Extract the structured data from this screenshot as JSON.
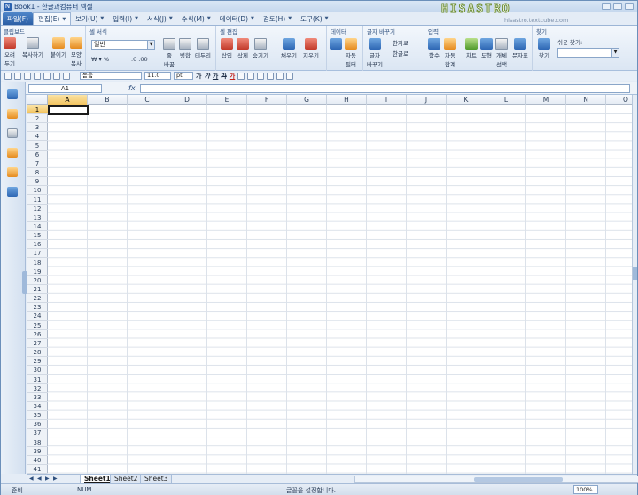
{
  "window": {
    "title": "Book1 - 한글과컴퓨터 넥셀"
  },
  "watermark": {
    "text": "HISASTRO",
    "url": "hisastro.textcube.com"
  },
  "menu": [
    {
      "label": "파일(F)",
      "kind": "file"
    },
    {
      "label": "편집(E)",
      "kind": "active"
    },
    {
      "label": "보기(U)"
    },
    {
      "label": "입력(I)"
    },
    {
      "label": "서식(J)"
    },
    {
      "label": "수식(M)"
    },
    {
      "label": "데이터(D)"
    },
    {
      "label": "검토(H)"
    },
    {
      "label": "도구(K)"
    }
  ],
  "ribbon": {
    "clipboard": {
      "title": "클립보드",
      "cut": "오려\n두기",
      "copy": "복사하기",
      "paste": "붙이기",
      "format_copy": "모양\n복사"
    },
    "cellformat": {
      "title": "셀 서식",
      "format_value": "일반"
    },
    "align": {
      "wrap": "줄\n바꿈",
      "merge": "병합",
      "border": "테두리"
    },
    "celledit": {
      "title": "셀 편집",
      "insert": "삽입",
      "delete": "삭제",
      "hide": "숨기기"
    },
    "fill": {
      "fill": "채우기",
      "clear": "지우기"
    },
    "data": {
      "title": "데이터",
      "sort": "",
      "filter": "자동\n필터"
    },
    "convert": {
      "title": "글자 바꾸기",
      "change": "글자\n바꾸기",
      "hanja": "한자로",
      "hangul": "한글로"
    },
    "input": {
      "title": "입력",
      "func": "함수",
      "autosum": "자동\n합계",
      "chart": "차트",
      "shape": "도형",
      "object": "개체\n선택",
      "symbol": "문자표"
    },
    "find": {
      "title": "찾기",
      "find_label": "찾기",
      "easy_find": "쉬운 찾기:"
    }
  },
  "quickbar": {
    "font": "돋움",
    "size": "11.0",
    "unit": "pt",
    "bold": "가",
    "italic": "가",
    "underline": "가",
    "strike": "가",
    "color": "가"
  },
  "formula": {
    "namebox": "A1",
    "fx": "fx",
    "value": ""
  },
  "grid": {
    "columns": [
      "A",
      "B",
      "C",
      "D",
      "E",
      "F",
      "G",
      "H",
      "I",
      "J",
      "K",
      "L",
      "M",
      "N",
      "O"
    ],
    "rows": [
      "1",
      "2",
      "3",
      "4",
      "5",
      "6",
      "7",
      "8",
      "9",
      "10",
      "11",
      "12",
      "13",
      "14",
      "15",
      "16",
      "17",
      "18",
      "19",
      "20",
      "21",
      "22",
      "23",
      "24",
      "25",
      "26",
      "27",
      "28",
      "29",
      "30",
      "31",
      "32",
      "33",
      "34",
      "35",
      "36",
      "37",
      "38",
      "39",
      "40",
      "41"
    ],
    "active_cell": "A1"
  },
  "sheets": [
    {
      "name": "Sheet1",
      "active": true
    },
    {
      "name": "Sheet2"
    },
    {
      "name": "Sheet3"
    }
  ],
  "status": {
    "ready": "준비",
    "num": "NUM",
    "message": "글꼴을 설정합니다.",
    "zoom": "100%"
  }
}
